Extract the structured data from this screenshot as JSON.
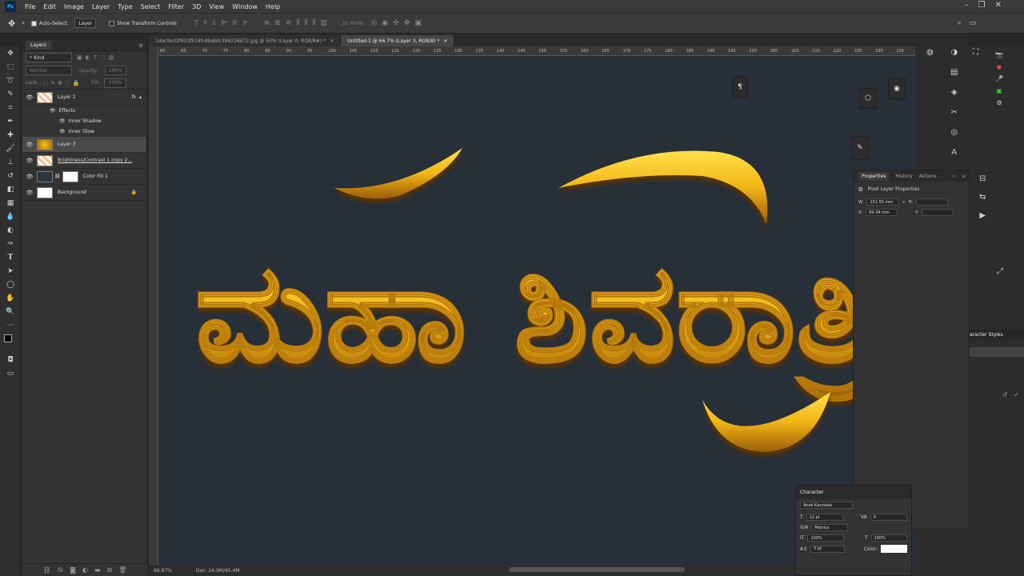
{
  "menu": [
    "File",
    "Edit",
    "Image",
    "Layer",
    "Type",
    "Select",
    "Filter",
    "3D",
    "View",
    "Window",
    "Help"
  ],
  "options": {
    "auto_select": "Auto-Select:",
    "target": "Layer",
    "show_transform": "Show Transform Controls",
    "mode3d": "3D Mode:"
  },
  "tabs": [
    {
      "label": "1dac9e32f633f518549a8dc386226d72.jpg @ 50% (Layer 0, RGB/8#) *"
    },
    {
      "label": "Untitled-1 @ 66.7% (Layer 3, RGB/8) *"
    }
  ],
  "layers_panel": {
    "title": "Layers",
    "kind": "Kind",
    "blend": "Normal",
    "opacity_label": "Opacity:",
    "opacity": "100%",
    "lock_label": "Lock:",
    "fill_label": "Fill:",
    "fill": "100%",
    "layers": [
      {
        "name": "Layer 2",
        "fx": "fx"
      },
      {
        "name": "Effects"
      },
      {
        "name": "Inner Shadow"
      },
      {
        "name": "Inner Glow"
      },
      {
        "name": "Layer 3"
      },
      {
        "name": "Brightness/Contrast 1 copy 2..."
      },
      {
        "name": "Color Fill 1"
      },
      {
        "name": "Background"
      }
    ]
  },
  "ruler_ticks": [
    "60",
    "65",
    "70",
    "75",
    "80",
    "85",
    "90",
    "95",
    "100",
    "105",
    "110",
    "115",
    "120",
    "125",
    "130",
    "135",
    "140",
    "145",
    "150",
    "155",
    "160",
    "165",
    "170",
    "175",
    "180",
    "185",
    "190",
    "195",
    "200",
    "205",
    "210",
    "215",
    "220",
    "225",
    "230",
    "235"
  ],
  "status": {
    "zoom": "66.67%",
    "doc": "Doc: 24.9M/45.4M"
  },
  "properties": {
    "tabs": [
      "Properties",
      "History",
      "Actions"
    ],
    "title": "Pixel Layer Properties",
    "w_label": "W:",
    "w": "151.55 mm",
    "h_label": "H:",
    "x_label": "X:",
    "x": "69.34 mm",
    "y_label": "Y:"
  },
  "character": {
    "title": "Character",
    "font": "Anek Kannada",
    "size": "12 pt",
    "kerning": "Metrics",
    "tracking": "0",
    "vscale": "100%",
    "hscale": "100%",
    "baseline": "0 pt",
    "color_label": "Color:"
  },
  "char_styles": "aracter Styles",
  "artwork_text": "ಮಹಾ ಶಿವರಾತ್ರಿ",
  "colors": {
    "gold_light": "#ffe14a",
    "gold_mid": "#f2b515",
    "gold_dark": "#9a5d06",
    "canvas_bg": "#272f39"
  }
}
